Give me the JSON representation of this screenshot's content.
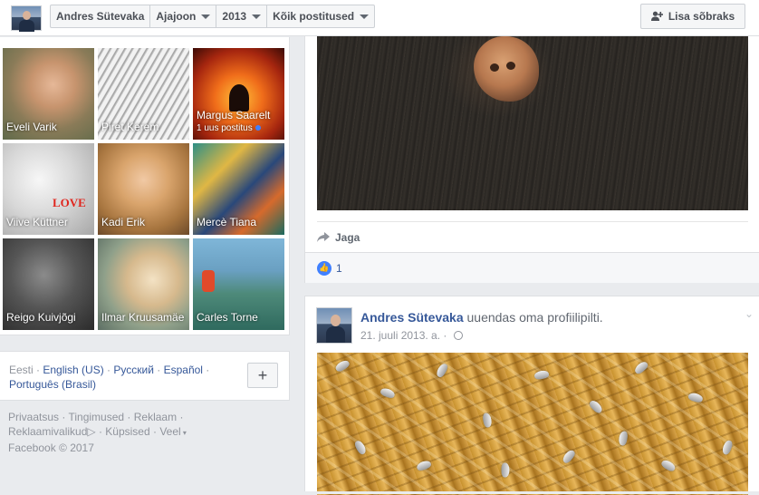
{
  "topbar": {
    "profile_name": "Andres Sütevaka",
    "timeline_label": "Ajajoon",
    "year_label": "2013",
    "filter_label": "Kõik postitused",
    "add_friend_label": "Lisa sõbraks"
  },
  "friends": [
    {
      "name": "Eveli Varik",
      "sub": ""
    },
    {
      "name": "Piret Kerem",
      "sub": ""
    },
    {
      "name": "Margus Saarelt",
      "sub": "1 uus postitus"
    },
    {
      "name": "Viive Küttner",
      "sub": ""
    },
    {
      "name": "Kadi Erik",
      "sub": ""
    },
    {
      "name": "Mercè Tiana",
      "sub": ""
    },
    {
      "name": "Reigo Kuivjõgi",
      "sub": ""
    },
    {
      "name": "Ilmar Kruusamäe",
      "sub": ""
    },
    {
      "name": "Carles Torne",
      "sub": ""
    }
  ],
  "love_text": "LOVE",
  "languages": {
    "current": "Eesti",
    "options": [
      "English (US)",
      "Русский",
      "Español",
      "Português (Brasil)"
    ],
    "add_label": "+"
  },
  "footer": {
    "links": [
      "Privaatsus",
      "Tingimused",
      "Reklaam",
      "Reklaamivalikud",
      "Küpsised",
      "Veel"
    ],
    "copyright": "Facebook © 2017"
  },
  "post1": {
    "share_label": "Jaga",
    "like_count": "1"
  },
  "post2": {
    "author": "Andres Sütevaka",
    "action": "uuendas oma profiilipilti.",
    "date": "21. juuli 2013. a."
  },
  "icons": {
    "add_friend": "add-friend-icon",
    "share": "share-arrow-icon",
    "like": "thumbs-up-icon",
    "privacy": "globe-icon",
    "options": "chevron-down-icon"
  },
  "colors": {
    "link": "#365899",
    "like_blue": "#4080ff",
    "muted": "#90949c",
    "background": "#e9ebee"
  }
}
